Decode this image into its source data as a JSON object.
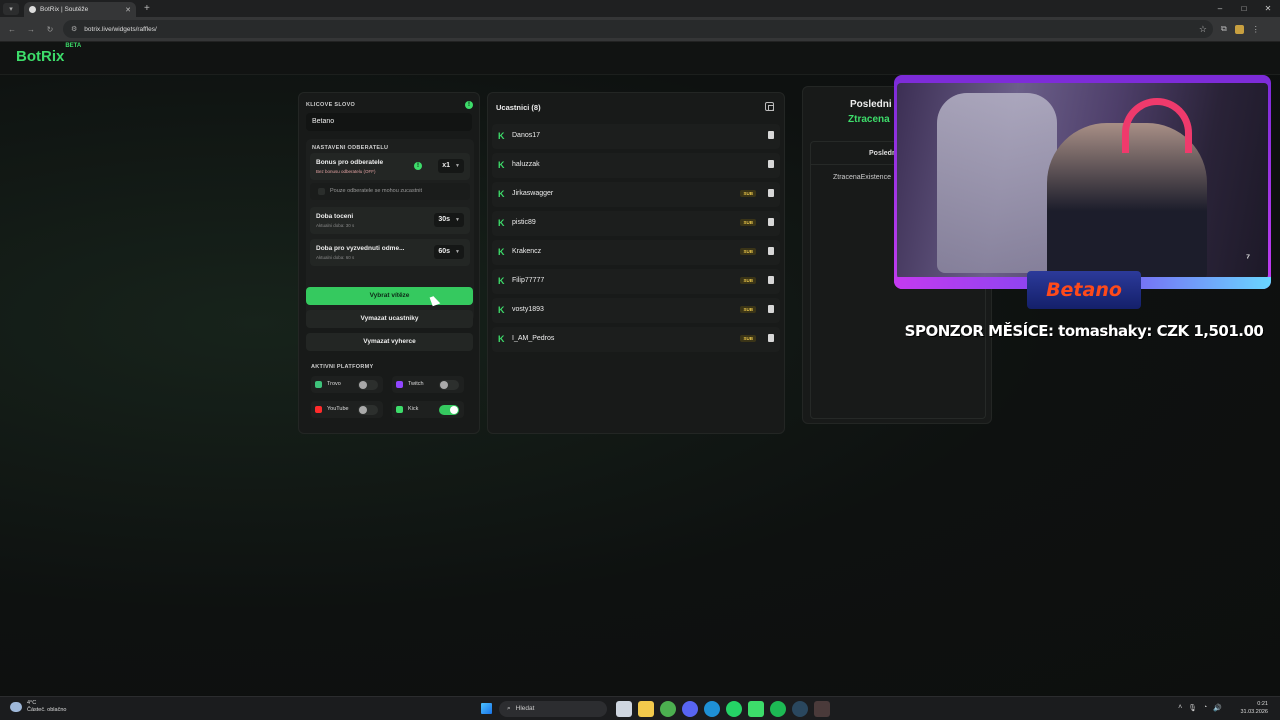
{
  "browser": {
    "tab_title": "BotRix | Soutěže",
    "url": "botrix.live/widgets/raffles/"
  },
  "header": {
    "logo": "BotRix",
    "logo_badge": "BETA"
  },
  "settings": {
    "keyword_label": "KLICOVE SLOVO",
    "keyword_value": "Betano",
    "subs_section": "NASTAVENI ODBERATELU",
    "bonus_title": "Bonus pro odberatele",
    "bonus_sub": "Bez bonusu odberatelu (OFF)",
    "bonus_value": "x1",
    "only_subs_label": "Pouze odberatele se mohou zucastnit",
    "spin_title": "Doba toceni",
    "spin_sub": "Aktualni doba: 30 s",
    "spin_value": "30s",
    "claim_title": "Doba pro vyzvednuti odme...",
    "claim_sub": "Aktualni doba: 60 s",
    "claim_value": "60s",
    "btn_pick": "Vybrat vítěze",
    "btn_clear_participants": "Vymazat ucastniky",
    "btn_clear_winners": "Vymazat vyherce",
    "platforms_label": "AKTIVNI PLATFORMY",
    "platforms": [
      {
        "name": "Trovo",
        "on": false,
        "color": "#3ec27a"
      },
      {
        "name": "Twitch",
        "on": false,
        "color": "#9146ff"
      },
      {
        "name": "YouTube",
        "on": false,
        "color": "#ff2b2b"
      },
      {
        "name": "Kick",
        "on": true,
        "color": "#3ddc6a"
      }
    ]
  },
  "participants": {
    "title": "Ucastnici (8)",
    "sub_badge": "SUB",
    "items": [
      {
        "name": "Danos17",
        "sub": false
      },
      {
        "name": "haluzzak",
        "sub": false
      },
      {
        "name": "Jirkaswagger",
        "sub": true
      },
      {
        "name": "pistic89",
        "sub": true
      },
      {
        "name": "Krakencz",
        "sub": true
      },
      {
        "name": "Filip77777",
        "sub": true
      },
      {
        "name": "vosty1893",
        "sub": true
      },
      {
        "name": "I_AM_Pedros",
        "sub": true
      }
    ]
  },
  "winners": {
    "title": "Posledni",
    "subtitle": "Ztracena",
    "list_header": "Posledn",
    "entry": "ZtracenaExistence"
  },
  "overlay": {
    "brand": "Betano",
    "sponsor_text": "SPONZOR MĚSÍCE: tomashaky: CZK 1,501.00"
  },
  "taskbar": {
    "weather_temp": "4°C",
    "weather_desc": "Částeč. oblačno",
    "search_placeholder": "Hledat",
    "time": "0:21",
    "date": "31.03.2026"
  }
}
